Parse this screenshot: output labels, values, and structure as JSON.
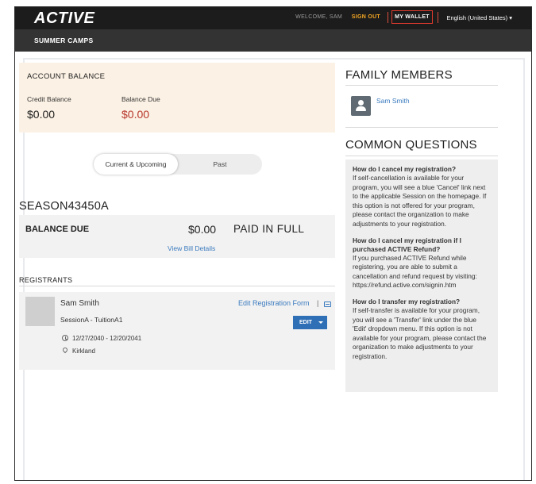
{
  "header": {
    "logo_text": "ACTIVE",
    "welcome": "WELCOME, SAM",
    "sign_out": "SIGN OUT",
    "my_wallet": "MY WALLET",
    "language": "English (United States) ▾"
  },
  "subheader": {
    "title": "SUMMER CAMPS"
  },
  "account_balance": {
    "heading": "ACCOUNT BALANCE",
    "credit_label": "Credit Balance",
    "credit_value": "$0.00",
    "due_label": "Balance Due",
    "due_value": "$0.00"
  },
  "tabs": {
    "current": "Current & Upcoming",
    "past": "Past"
  },
  "season": {
    "id": "SEASON43450A",
    "balance_label": "BALANCE DUE",
    "balance_value": "$0.00",
    "status": "PAID IN FULL",
    "bill_link": "View Bill Details"
  },
  "registrants": {
    "heading": "REGISTRANTS",
    "items": [
      {
        "name": "Sam Smith",
        "session": "SessionA - TuitionA1",
        "dates": "12/27/2040 - 12/20/2041",
        "location": "Kirkland",
        "edit_form": "Edit Registration Form",
        "pipe": "|",
        "edit_button": "EDIT"
      }
    ]
  },
  "family": {
    "heading": "FAMILY MEMBERS",
    "members": [
      {
        "name": "Sam Smith"
      }
    ]
  },
  "faq": {
    "heading": "COMMON QUESTIONS",
    "items": [
      {
        "q": "How do I cancel my registration?",
        "a": "If self-cancellation is available for your program, you will see a blue 'Cancel' link next to the applicable Session on the homepage. If this option is not offered for your program, please contact the organization to make adjustments to your registration."
      },
      {
        "q": "How do I cancel my registration if I purchased ACTIVE Refund?",
        "a": "If you purchased ACTIVE Refund while registering, you are able to submit a cancellation and refund request by visiting: https://refund.active.com/signin.htm"
      },
      {
        "q": "How do I transfer my registration?",
        "a": "If self-transfer is available for your program, you will see a 'Transfer' link under the blue 'Edit' dropdown menu. If this option is not available for your program, please contact the organization to make adjustments to your registration."
      }
    ]
  },
  "colors": {
    "topbar": "#1c1c1c",
    "subbar": "#333333",
    "accent_orange": "#f5a623",
    "link_blue": "#3b7bbf",
    "button_blue": "#2f6fb5",
    "balance_due_red": "#c0392b",
    "account_panel_bg": "#fbf1e4"
  }
}
